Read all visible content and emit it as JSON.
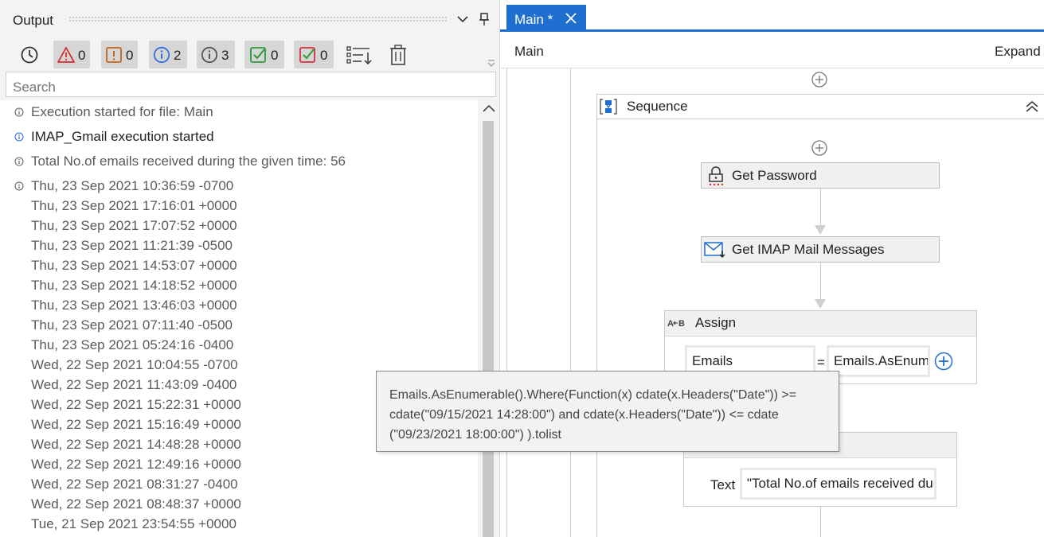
{
  "output": {
    "title": "Output",
    "toolbar": {
      "error_count": "0",
      "warning_count": "0",
      "info_count": "2",
      "trace_count": "3",
      "success_count": "0",
      "failed_count": "0"
    },
    "search_placeholder": "Search",
    "log": [
      {
        "icon": "trace-icon",
        "text": "Execution started for file: Main"
      },
      {
        "icon": "info-icon",
        "text": "IMAP_Gmail execution started"
      },
      {
        "icon": "trace-icon",
        "text": "Total No.of emails received during the given time: 56"
      },
      {
        "icon": "trace-icon",
        "text": "Thu, 23 Sep 2021 10:36:59 -0700"
      },
      {
        "icon": "",
        "text": "Thu, 23 Sep 2021 17:16:01 +0000"
      },
      {
        "icon": "",
        "text": "Thu, 23 Sep 2021 17:07:52 +0000"
      },
      {
        "icon": "",
        "text": "Thu, 23 Sep 2021 11:21:39 -0500"
      },
      {
        "icon": "",
        "text": "Thu, 23 Sep 2021 14:53:07 +0000"
      },
      {
        "icon": "",
        "text": "Thu, 23 Sep 2021 14:18:52 +0000"
      },
      {
        "icon": "",
        "text": "Thu, 23 Sep 2021 13:46:03 +0000"
      },
      {
        "icon": "",
        "text": "Thu, 23 Sep 2021 07:11:40 -0500"
      },
      {
        "icon": "",
        "text": "Thu, 23 Sep 2021 05:24:16 -0400"
      },
      {
        "icon": "",
        "text": "Wed, 22 Sep 2021 10:04:55 -0700"
      },
      {
        "icon": "",
        "text": "Wed, 22 Sep 2021 11:43:09 -0400"
      },
      {
        "icon": "",
        "text": "Wed, 22 Sep 2021 15:22:31 +0000"
      },
      {
        "icon": "",
        "text": "Wed, 22 Sep 2021 15:16:49 +0000"
      },
      {
        "icon": "",
        "text": "Wed, 22 Sep 2021 14:48:28 +0000"
      },
      {
        "icon": "",
        "text": "Wed, 22 Sep 2021 12:49:16 +0000"
      },
      {
        "icon": "",
        "text": "Wed, 22 Sep 2021 08:31:27 -0400"
      },
      {
        "icon": "",
        "text": "Wed, 22 Sep 2021 08:48:37 +0000"
      },
      {
        "icon": "",
        "text": "Tue, 21 Sep 2021 23:54:55 +0000"
      }
    ]
  },
  "designer": {
    "tab_label": "Main *",
    "breadcrumb": "Main",
    "expand_label": "Expand",
    "sequence_label": "Sequence",
    "activities": {
      "get_password": "Get Password",
      "get_mail": "Get IMAP Mail Messages",
      "assign_label": "Assign",
      "assign_to": "Emails",
      "assign_eq": "=",
      "assign_value": "Emails.AsEnumerable()",
      "log_text_label": "Text",
      "log_text_value": "\"Total No.of emails received during the given time: \""
    }
  },
  "tooltip": {
    "text": "Emails.AsEnumerable().Where(Function(x) cdate(x.Headers(\"Date\")) >= cdate(\"09/15/2021 14:28:00\") and cdate(x.Headers(\"Date\")) <= cdate (\"09/23/2021 18:00:00\") ).tolist"
  },
  "colors": {
    "accent": "#1f6fd0",
    "error": "#d62b2b",
    "warning": "#c0651a",
    "info": "#2f6fe0",
    "success": "#2a9a3a",
    "failed": "#d6303a"
  }
}
